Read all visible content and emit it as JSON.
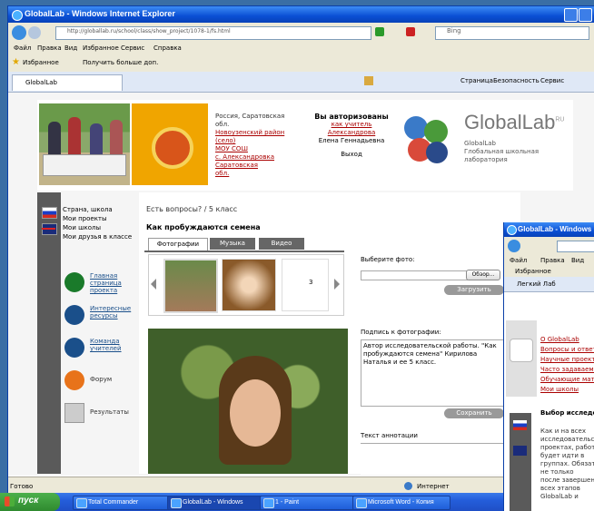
{
  "main_window": {
    "title": "GlobalLab - Windows Internet Explorer",
    "address": "http://globallab.ru/school/class/show_project/1078-1/fs.html",
    "search_engine": "Bing",
    "menu": [
      "Файл",
      "Правка",
      "Вид",
      "Избранное",
      "Сервис",
      "Справка"
    ],
    "favorites_label": "Избранное",
    "favorites_link": "Получить больше доп.",
    "tab_label": "GlobalLab",
    "cmd_bar": [
      "Страница",
      "Безопасность",
      "Сервис"
    ],
    "status_left": "Готово",
    "status_zone": "Интернет"
  },
  "site": {
    "school_lines": [
      "Россия, Саратовская",
      "обл.",
      "Новоузенский район",
      "(село)",
      "МОУ СОШ",
      "с. Александровка",
      "Саратовская",
      "обл."
    ],
    "auth_title": "Вы авторизованы",
    "auth_lines": [
      "как учитель",
      "Александрова",
      "Елена Геннадьевна"
    ],
    "logout": "Выход",
    "logo_text": "GlobalLab",
    "logo_sup": "RU",
    "logo_lines": [
      "GlobalLab",
      "Глобальная школьная",
      "лаборатория"
    ],
    "sidebar_links": [
      "Страна, школа",
      "Мои проекты",
      "Мои школы",
      "Мои друзья в классе"
    ],
    "sidebar_icons": [
      {
        "label": "Главная страница проекта",
        "color": "#1a7a2a"
      },
      {
        "label": "Интересные ресурсы",
        "color": "#1a4f8a"
      },
      {
        "label": "Команда учителей",
        "color": "#1a4f8a"
      },
      {
        "label": "Форум",
        "color": "#e8731a"
      },
      {
        "label": "Результаты",
        "color": "#888888"
      }
    ],
    "breadcrumb": "Есть вопросы? / 5 класс",
    "project_title": "Как пробуждаются семена",
    "tabs": [
      "Фотографии",
      "Музыка",
      "Видео"
    ],
    "page_num": "3",
    "choose_photo": "Выберите фото:",
    "browse": "Обзор...",
    "upload": "Загрузить",
    "caption_label": "Подпись к фотографии:",
    "caption_text": "Автор исследовательской работы. \"Как пробуждаются семена\" Кирилова Наталья и ее 5 класс.",
    "save": "Сохранить",
    "annotation_label": "Текст аннотации"
  },
  "second_window": {
    "title": "GlobalLab - Windows",
    "menu": [
      "Файл",
      "Правка",
      "Вид"
    ],
    "fav": "Избранное",
    "tab": "Легкий Лаб",
    "items": [
      "О GlobalLab",
      "Вопросы и ответы",
      "Научные проекты",
      "Часто задаваемые",
      "Обучающие материалы",
      "Мои школы"
    ],
    "heading": "Выбор исследования",
    "body_lines": [
      "Как и на всех",
      "исследовательских",
      "проектах, работа",
      "будет идти в",
      "группах. Обязательно",
      "не только",
      "после завершения",
      "всех этапов",
      "GlobalLab и"
    ]
  },
  "taskbar": {
    "start": "пуск",
    "buttons": [
      "Total Commander",
      "GlobalLab - Windows",
      "1 - Paint",
      "Microsoft Word - Копия"
    ]
  },
  "colors": {
    "xp_blue": "#0a4fd4",
    "taskbar": "#245edb",
    "start_green": "#3c9a3c",
    "link_red": "#aa0000"
  }
}
